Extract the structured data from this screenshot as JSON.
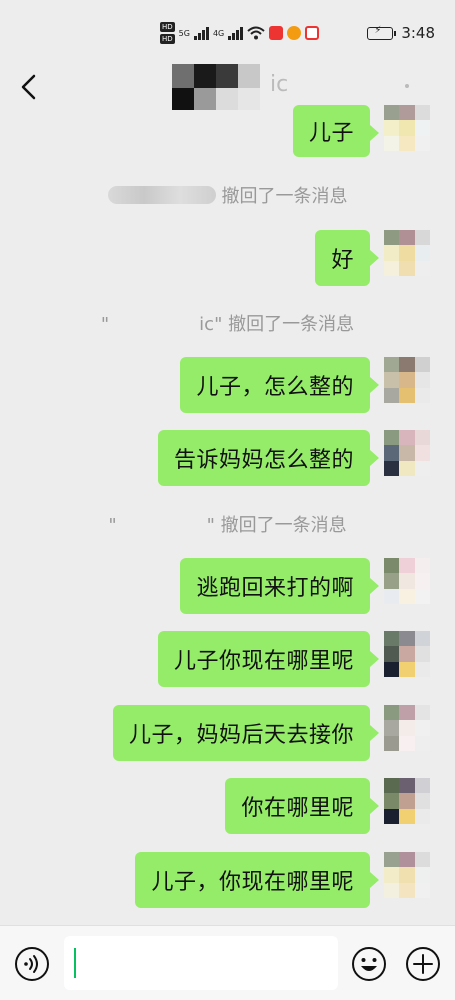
{
  "status_bar": {
    "time": "3:48",
    "hd1": "HD",
    "hd2": "HD",
    "net1": "5G",
    "net2": "4G"
  },
  "header": {
    "title_suffix": "ic",
    "back_icon": "chevron-left-icon",
    "more_icon": "more-dots-icon"
  },
  "messages": [
    {
      "type": "sent",
      "text": "儿子"
    },
    {
      "type": "system",
      "text": "撤回了一条消息"
    },
    {
      "type": "sent",
      "text": "好"
    },
    {
      "type": "system",
      "text": "\"　　　　　ic\" 撤回了一条消息"
    },
    {
      "type": "sent",
      "text": "儿子，怎么整的"
    },
    {
      "type": "sent",
      "text": "告诉妈妈怎么整的"
    },
    {
      "type": "system",
      "text": "\"　　　　　\" 撤回了一条消息"
    },
    {
      "type": "sent",
      "text": "逃跑回来打的啊"
    },
    {
      "type": "sent",
      "text": "儿子你现在哪里呢"
    },
    {
      "type": "sent",
      "text": "儿子，妈妈后天去接你"
    },
    {
      "type": "sent",
      "text": "你在哪里呢"
    },
    {
      "type": "sent",
      "text": "儿子，你现在哪里呢"
    }
  ],
  "input_bar": {
    "value": "",
    "voice_icon": "voice-icon",
    "emoji_icon": "emoji-icon",
    "plus_icon": "plus-circle-icon"
  },
  "colors": {
    "bubble": "#95ec69",
    "background": "#ededed",
    "system_text": "#999999",
    "caret": "#07c160"
  }
}
